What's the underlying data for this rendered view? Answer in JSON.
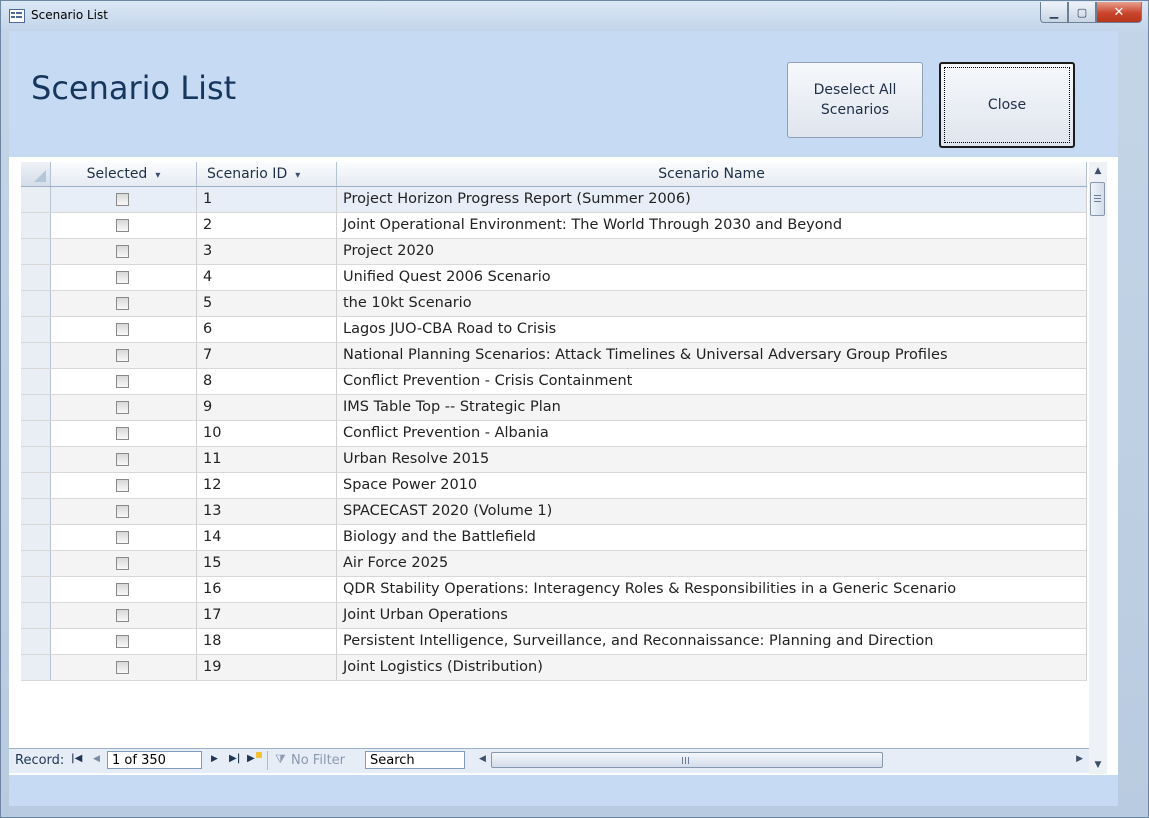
{
  "window": {
    "title": "Scenario List"
  },
  "header": {
    "title": "Scenario List",
    "deselect_label": "Deselect All Scenarios",
    "close_label": "Close"
  },
  "grid": {
    "columns": [
      {
        "label": "Selected",
        "sort_icon": "sort-filter-icon"
      },
      {
        "label": "Scenario ID",
        "sort_icon": "sort-filter-icon"
      },
      {
        "label": "Scenario Name"
      }
    ],
    "rows": [
      {
        "selected": false,
        "id": "1",
        "name": "Project Horizon Progress Report (Summer 2006)"
      },
      {
        "selected": false,
        "id": "2",
        "name": "Joint Operational Environment: The World Through 2030 and Beyond"
      },
      {
        "selected": false,
        "id": "3",
        "name": "Project 2020"
      },
      {
        "selected": false,
        "id": "4",
        "name": "Unified Quest 2006 Scenario"
      },
      {
        "selected": false,
        "id": "5",
        "name": "the 10kt Scenario"
      },
      {
        "selected": false,
        "id": "6",
        "name": "Lagos JUO-CBA Road to Crisis"
      },
      {
        "selected": false,
        "id": "7",
        "name": "National Planning Scenarios: Attack Timelines & Universal Adversary Group Profiles"
      },
      {
        "selected": false,
        "id": "8",
        "name": "Conflict Prevention - Crisis Containment"
      },
      {
        "selected": false,
        "id": "9",
        "name": "IMS Table Top -- Strategic Plan"
      },
      {
        "selected": false,
        "id": "10",
        "name": "Conflict Prevention - Albania"
      },
      {
        "selected": false,
        "id": "11",
        "name": "Urban Resolve 2015"
      },
      {
        "selected": false,
        "id": "12",
        "name": "Space Power 2010"
      },
      {
        "selected": false,
        "id": "13",
        "name": "SPACECAST 2020 (Volume 1)"
      },
      {
        "selected": false,
        "id": "14",
        "name": "Biology and the Battlefield"
      },
      {
        "selected": false,
        "id": "15",
        "name": "Air Force 2025"
      },
      {
        "selected": false,
        "id": "16",
        "name": "QDR Stability Operations: Interagency Roles & Responsibilities in a Generic Scenario"
      },
      {
        "selected": false,
        "id": "17",
        "name": "Joint Urban Operations"
      },
      {
        "selected": false,
        "id": "18",
        "name": "Persistent Intelligence, Surveillance, and Reconnaissance: Planning and Direction"
      },
      {
        "selected": false,
        "id": "19",
        "name": "Joint Logistics (Distribution)"
      }
    ]
  },
  "navigation": {
    "record_label": "Record:",
    "current": "1 of 350",
    "filter_label": "No Filter",
    "search_label": "Search"
  }
}
